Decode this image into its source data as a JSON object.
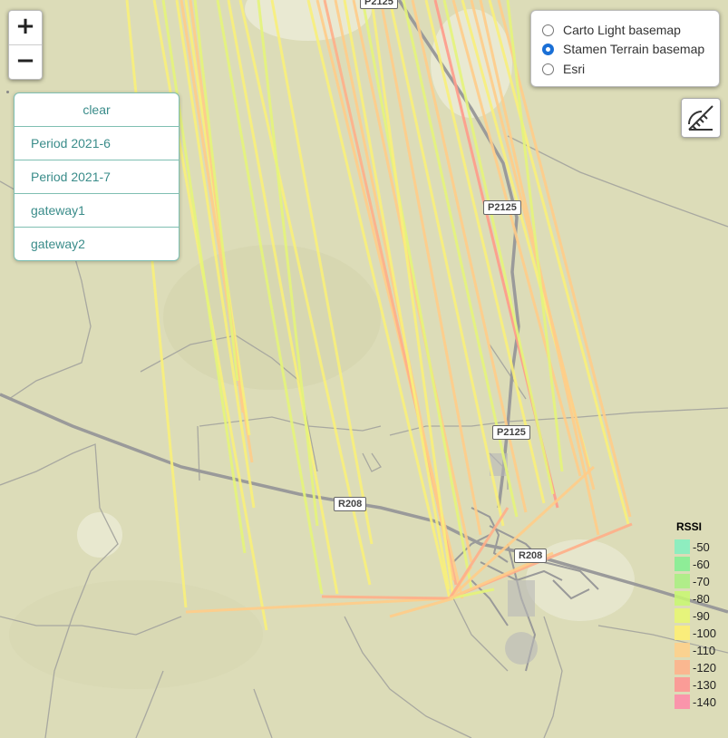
{
  "zoom": {
    "in": "+",
    "out": "−"
  },
  "filters": [
    "clear",
    "Period 2021-6",
    "Period 2021-7",
    "gateway1",
    "gateway2"
  ],
  "basemaps": [
    {
      "label": "Carto Light basemap",
      "selected": false
    },
    {
      "label": "Stamen Terrain basemap",
      "selected": true
    },
    {
      "label": "Esri",
      "selected": false
    }
  ],
  "road_labels": [
    "P2125",
    "P2125",
    "P2125",
    "R208",
    "R208"
  ],
  "legend": {
    "title": "RSSI",
    "items": [
      {
        "value": "-50",
        "color": "#80f0c0"
      },
      {
        "value": "-60",
        "color": "#80f090"
      },
      {
        "value": "-70",
        "color": "#a8f080"
      },
      {
        "value": "-80",
        "color": "#c8f870"
      },
      {
        "value": "-90",
        "color": "#e8f870"
      },
      {
        "value": "-100",
        "color": "#fff070"
      },
      {
        "value": "-110",
        "color": "#ffd088"
      },
      {
        "value": "-120",
        "color": "#ffb088"
      },
      {
        "value": "-130",
        "color": "#ff9090"
      },
      {
        "value": "-140",
        "color": "#ff88a8"
      }
    ]
  }
}
